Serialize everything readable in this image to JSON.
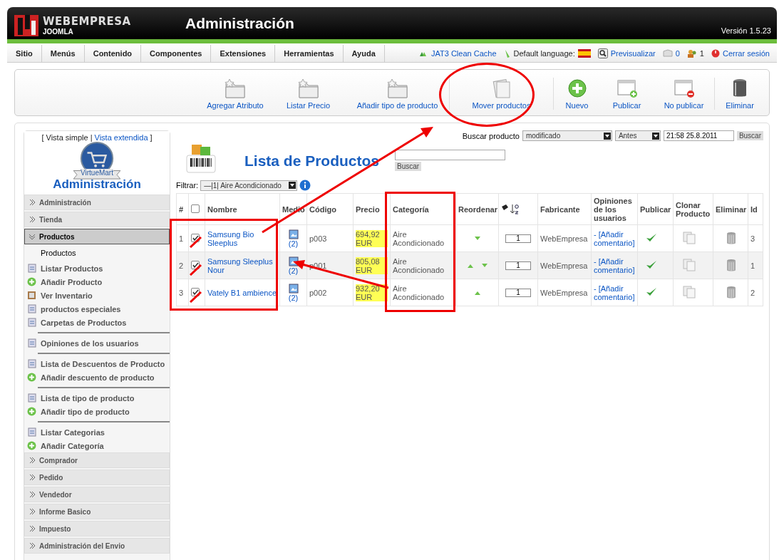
{
  "header": {
    "brand": "WEBEMPRESA",
    "brand_sub": "JOOMLA",
    "title": "Administración",
    "version": "Versión 1.5.23"
  },
  "menu": [
    "Sitio",
    "Menús",
    "Contenido",
    "Componentes",
    "Extensiones",
    "Herramientas",
    "Ayuda"
  ],
  "status": [
    {
      "kind": "cache",
      "label": "JAT3 Clean Cache"
    },
    {
      "kind": "language",
      "label": "Default language:"
    },
    {
      "kind": "preview",
      "label": "Previsualizar"
    },
    {
      "kind": "messages",
      "label": "0"
    },
    {
      "kind": "users",
      "label": "1"
    },
    {
      "kind": "logout",
      "label": "Cerrar sesión"
    }
  ],
  "toolbar": [
    {
      "kind": "folder",
      "label": "Agregar Atributo"
    },
    {
      "kind": "folder",
      "label": "Listar Precio"
    },
    {
      "kind": "folder",
      "label": "Añadir tipo de producto"
    },
    {
      "kind": "move",
      "label": "Mover productos"
    },
    {
      "kind": "new",
      "label": "Nuevo"
    },
    {
      "kind": "publish",
      "label": "Publicar"
    },
    {
      "kind": "unpublish",
      "label": "No publicar"
    },
    {
      "kind": "trash",
      "label": "Eliminar"
    }
  ],
  "sidebar": {
    "view_prefix": "[ Vista simple |",
    "view_link": "Vista extendida",
    "view_suffix": "]",
    "logo_text": "VirtueMart",
    "title": "Administración",
    "sections": [
      {
        "label": "Administración",
        "expanded": false
      },
      {
        "label": "Tienda",
        "expanded": false
      },
      {
        "label": "Productos",
        "expanded": true,
        "heading": "Productos",
        "groups": [
          {
            "items": [
              {
                "kind": "list",
                "label": "Listar Productos"
              },
              {
                "kind": "add",
                "label": "Añadir Producto"
              },
              {
                "kind": "inventory",
                "label": "Ver Inventario"
              },
              {
                "kind": "list",
                "label": "productos especiales"
              },
              {
                "kind": "list",
                "label": "Carpetas de Productos"
              }
            ]
          },
          {
            "items": [
              {
                "kind": "list",
                "label": "Opiniones de los usuarios"
              }
            ]
          },
          {
            "items": [
              {
                "kind": "list",
                "label": "Lista de Descuentos de Producto"
              },
              {
                "kind": "add",
                "label": "Añadir descuento de producto"
              }
            ]
          },
          {
            "items": [
              {
                "kind": "list",
                "label": "Lista de tipo de producto"
              },
              {
                "kind": "add",
                "label": "Añadir tipo de producto"
              }
            ]
          },
          {
            "items": [
              {
                "kind": "list",
                "label": "Listar Categorias"
              },
              {
                "kind": "add",
                "label": "Añadir Categoría"
              }
            ]
          }
        ]
      },
      {
        "label": "Comprador",
        "expanded": false
      },
      {
        "label": "Pedido",
        "expanded": false
      },
      {
        "label": "Vendedor",
        "expanded": false
      },
      {
        "label": "Informe Basico",
        "expanded": false
      },
      {
        "label": "Impuesto",
        "expanded": false
      },
      {
        "label": "Administración del Envio",
        "expanded": false
      }
    ]
  },
  "search": {
    "label": "Buscar producto",
    "field": "modificado",
    "order": "Antes",
    "date": "21:58 25.8.2011",
    "button": "Buscar"
  },
  "title": "Lista de Productos",
  "keyword_button": "Buscar",
  "filter": {
    "label": "Filtrar:",
    "value": "—|1| Aire Acondicionado"
  },
  "table": {
    "select_all_checked": false,
    "columns": [
      {
        "kind": "text",
        "label": "#"
      },
      {
        "kind": "check"
      },
      {
        "kind": "text",
        "label": "Nombre"
      },
      {
        "kind": "text",
        "label": "Medio"
      },
      {
        "kind": "text",
        "label": "Código"
      },
      {
        "kind": "text",
        "label": "Precio"
      },
      {
        "kind": "text",
        "label": "Categoría"
      },
      {
        "kind": "text",
        "label": "Reordenar"
      },
      {
        "kind": "sort"
      },
      {
        "kind": "text",
        "label": "Fabricante"
      },
      {
        "kind": "text",
        "label": "Opiniones de los usuarios"
      },
      {
        "kind": "text",
        "label": "Publicar"
      },
      {
        "kind": "text",
        "label": "Clonar Producto"
      },
      {
        "kind": "text",
        "label": "Eliminar"
      },
      {
        "kind": "text",
        "label": "Id"
      }
    ],
    "rows": [
      {
        "num": "1",
        "checked": true,
        "name": "Samsung Bio Sleeplus",
        "media": "(2)",
        "code": "p003",
        "price": "694,92 EUR",
        "category": "Aire Acondicionado",
        "move_up": false,
        "move_down": true,
        "order": "1",
        "maker": "WebEmpresa",
        "reviews": "- [Añadir comentario]",
        "published": true,
        "id": "3"
      },
      {
        "num": "2",
        "checked": true,
        "name": "Samsung Sleeplus Nour",
        "media": "(2)",
        "code": "p001",
        "price": "805,08 EUR",
        "category": "Aire Acondicionado",
        "move_up": true,
        "move_down": true,
        "order": "1",
        "maker": "WebEmpresa",
        "reviews": "- [Añadir comentario]",
        "published": true,
        "id": "1"
      },
      {
        "num": "3",
        "checked": true,
        "name": "Vately B1 ambience",
        "media": "(2)",
        "code": "p002",
        "price": "932,20 EUR",
        "category": "Aire Acondicionado",
        "move_up": true,
        "move_down": false,
        "order": "1",
        "maker": "WebEmpresa",
        "reviews": "- [Añadir comentario]",
        "published": true,
        "id": "2"
      }
    ]
  }
}
